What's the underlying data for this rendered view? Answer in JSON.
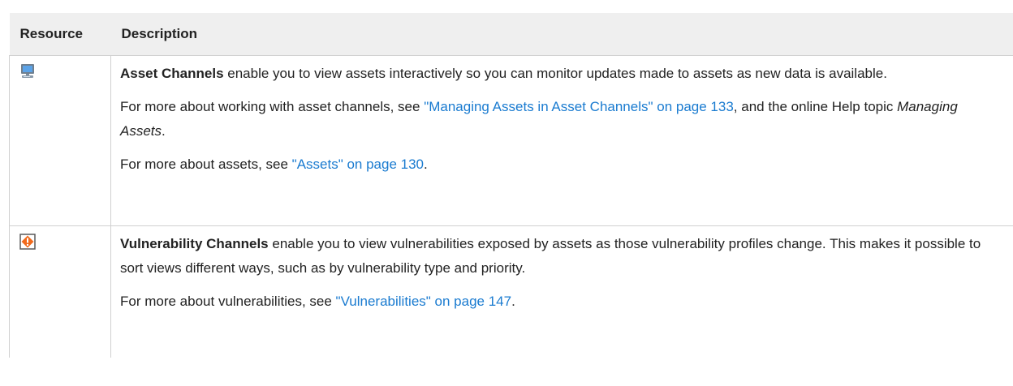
{
  "table": {
    "headers": {
      "resource": "Resource",
      "description": "Description"
    },
    "rows": [
      {
        "icon": "asset-channel-icon",
        "paragraphs": [
          {
            "bold": "Asset Channels",
            "text": " enable you to view assets interactively so you can monitor updates made to assets as new data is available."
          },
          {
            "prefix": "For more about working with asset channels, see ",
            "link": "\"Managing Assets in Asset Channels\" on page 133",
            "middle": ", and the online Help topic ",
            "italic": "Managing Assets",
            "suffix": "."
          },
          {
            "prefix": "For more about assets, see ",
            "link": "\"Assets\" on page 130",
            "suffix": "."
          }
        ]
      },
      {
        "icon": "vulnerability-channel-icon",
        "paragraphs": [
          {
            "bold": "Vulnerability Channels",
            "text": " enable you to view vulnerabilities exposed by assets as those vulnerability profiles change. This makes it possible to sort views different ways, such as by vulnerability type and priority."
          },
          {
            "prefix": "For more about vulnerabilities, see ",
            "link": "\"Vulnerabilities\" on page 147",
            "suffix": "."
          }
        ]
      }
    ]
  },
  "colors": {
    "header_bg": "#efefef",
    "link": "#1a7bd0",
    "border": "#d0d0d0",
    "text": "#222222"
  }
}
